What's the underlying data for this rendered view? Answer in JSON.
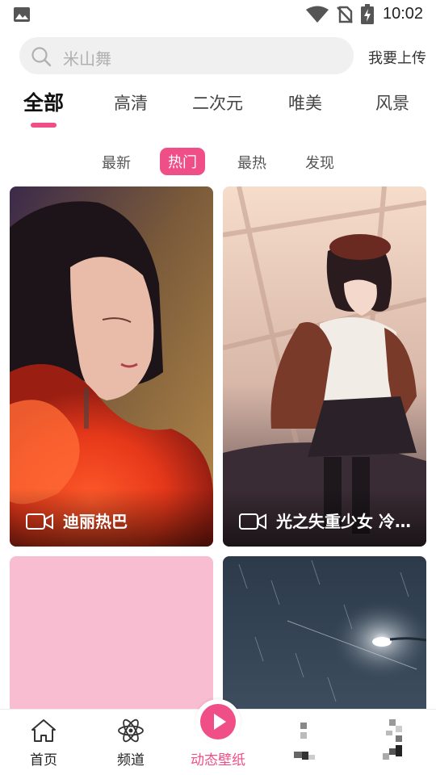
{
  "status_bar": {
    "time": "10:02",
    "icons": [
      "gallery-icon",
      "wifi-icon",
      "no-sim-icon",
      "battery-charging-icon"
    ]
  },
  "search": {
    "placeholder": "米山舞",
    "upload_label": "我要上传"
  },
  "category_tabs": [
    {
      "label": "全部",
      "active": true
    },
    {
      "label": "高清",
      "active": false
    },
    {
      "label": "二次元",
      "active": false
    },
    {
      "label": "唯美",
      "active": false
    },
    {
      "label": "风景",
      "active": false
    }
  ],
  "sort_tabs": [
    {
      "label": "最新",
      "active": false
    },
    {
      "label": "热门",
      "active": true
    },
    {
      "label": "最热",
      "active": false
    },
    {
      "label": "发现",
      "active": false
    }
  ],
  "cards": [
    {
      "title": "迪丽热巴",
      "type": "video"
    },
    {
      "title": "光之失重少女 冷…",
      "type": "video"
    },
    {
      "title": "",
      "type": "image"
    },
    {
      "title": "",
      "type": "image"
    }
  ],
  "bottom_nav": [
    {
      "label": "首页",
      "icon": "home-icon",
      "active": false
    },
    {
      "label": "频道",
      "icon": "atom-icon",
      "active": false
    },
    {
      "label": "动态壁纸",
      "icon": "play-icon",
      "active": true
    },
    {
      "label": "",
      "icon": "pixelated-icon",
      "active": false
    },
    {
      "label": "",
      "icon": "pixelated-icon",
      "active": false
    }
  ],
  "colors": {
    "accent": "#ef4f86",
    "search_bg": "#f0f0f0",
    "placeholder": "#b0b0b0"
  }
}
